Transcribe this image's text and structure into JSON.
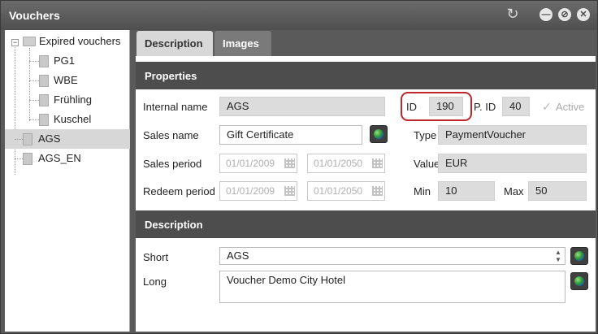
{
  "window": {
    "title": "Vouchers",
    "refresh_icon": "refresh-icon",
    "controls": [
      "minimize-icon",
      "restore-icon",
      "close-icon"
    ]
  },
  "tree": {
    "root": {
      "label": "Expired vouchers",
      "icon": "folder-icon",
      "children": [
        "PG1",
        "WBE",
        "Frühling",
        "Kuschel"
      ]
    },
    "items": [
      {
        "label": "AGS",
        "selected": true
      },
      {
        "label": "AGS_EN",
        "selected": false
      }
    ]
  },
  "tabs": [
    {
      "label": "Description",
      "active": true
    },
    {
      "label": "Images",
      "active": false
    }
  ],
  "properties": {
    "header": "Properties",
    "internal_name": {
      "label": "Internal name",
      "value": "AGS"
    },
    "id": {
      "label": "ID",
      "value": "190"
    },
    "pid": {
      "label": "P. ID",
      "value": "40"
    },
    "active": {
      "label": "Active",
      "checked": true
    },
    "sales_name": {
      "label": "Sales name",
      "value": "Gift Certificate"
    },
    "type": {
      "label": "Type",
      "value": "PaymentVoucher"
    },
    "sales_period": {
      "label": "Sales period",
      "from": "01/01/2009",
      "to": "01/01/2050"
    },
    "value": {
      "label": "Value",
      "value": "EUR"
    },
    "redeem_period": {
      "label": "Redeem period",
      "from": "01/01/2009",
      "to": "01/01/2050"
    },
    "min": {
      "label": "Min",
      "value": "10"
    },
    "max": {
      "label": "Max",
      "value": "50"
    }
  },
  "description": {
    "header": "Description",
    "short": {
      "label": "Short",
      "value": "AGS"
    },
    "long": {
      "label": "Long",
      "value": "Voucher Demo City Hotel"
    }
  },
  "colors": {
    "title_bar": "#5a5a5a",
    "section_header": "#4d4d4d",
    "highlight": "#c0262a",
    "field_background": "#dcdcdc"
  }
}
